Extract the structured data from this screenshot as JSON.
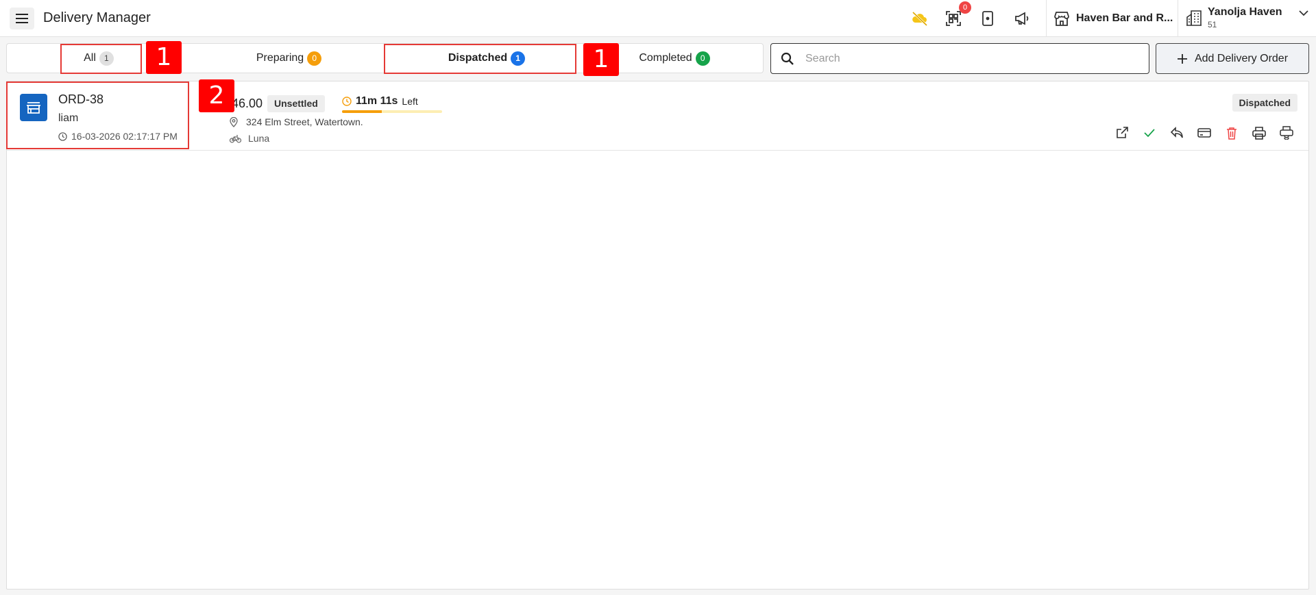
{
  "header": {
    "title": "Delivery Manager",
    "notification_count": "0",
    "store_name": "Haven Bar and R...",
    "user_name": "Yanolja Haven",
    "user_sub": "51"
  },
  "tabs": [
    {
      "label": "All",
      "count": "1"
    },
    {
      "label": "Preparing",
      "count": "0"
    },
    {
      "label": "Dispatched",
      "count": "1"
    },
    {
      "label": "Completed",
      "count": "0"
    }
  ],
  "search": {
    "placeholder": "Search"
  },
  "add_button": {
    "label": "Add Delivery Order"
  },
  "order": {
    "id": "ORD-38",
    "customer": "liam",
    "datetime": "16-03-2026 02:17:17 PM",
    "amount": "46.00",
    "payment_status": "Unsettled",
    "timer": "11m 11s",
    "timer_suffix": "Left",
    "timer_progress": 0.4,
    "address": "324 Elm Street, Watertown.",
    "rider": "Luna",
    "status": "Dispatched"
  },
  "annotations": {
    "tabs_marker": "1",
    "dispatched_marker": "1",
    "order_marker": "2"
  },
  "colors": {
    "accent_blue": "#1a73e8",
    "badge_orange": "#f59e0b",
    "badge_green": "#16a34a",
    "order_icon": "#1565c0",
    "annotation_red": "#ff0000"
  }
}
